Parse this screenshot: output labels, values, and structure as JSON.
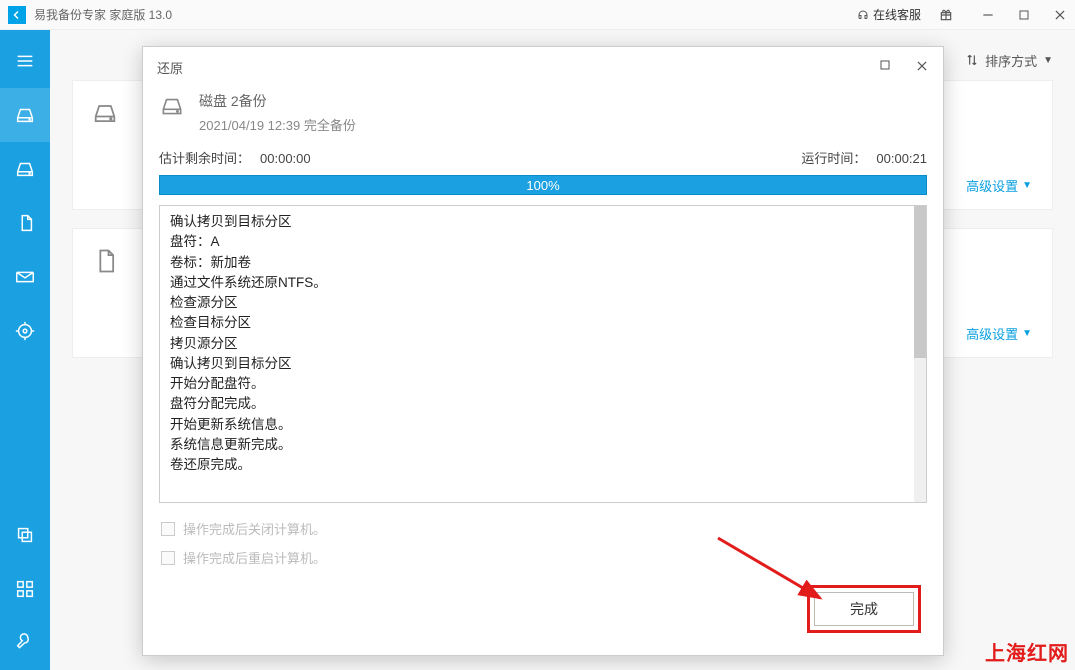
{
  "titlebar": {
    "app_name": "易我备份专家 家庭版 13.0",
    "online_support": "在线客服"
  },
  "sort": {
    "label": "排序方式"
  },
  "cards": {
    "advanced": "高级设置"
  },
  "modal": {
    "title": "还原",
    "header": {
      "name": "磁盘 2备份",
      "subtitle": "2021/04/19 12:39 完全备份"
    },
    "est_label": "估计剩余时间：",
    "est_value": "00:00:00",
    "run_label": "运行时间：",
    "run_value": "00:00:21",
    "progress_text": "100%",
    "log_lines": [
      "确认拷贝到目标分区",
      "盘符：A",
      "卷标：新加卷",
      "通过文件系统还原NTFS。",
      "检查源分区",
      "检查目标分区",
      "拷贝源分区",
      "确认拷贝到目标分区",
      "开始分配盘符。",
      "盘符分配完成。",
      "开始更新系统信息。",
      "系统信息更新完成。",
      "卷还原完成。"
    ],
    "opt_shutdown": "操作完成后关闭计算机。",
    "opt_restart": "操作完成后重启计算机。",
    "finish": "完成"
  },
  "watermark": "上海红网"
}
